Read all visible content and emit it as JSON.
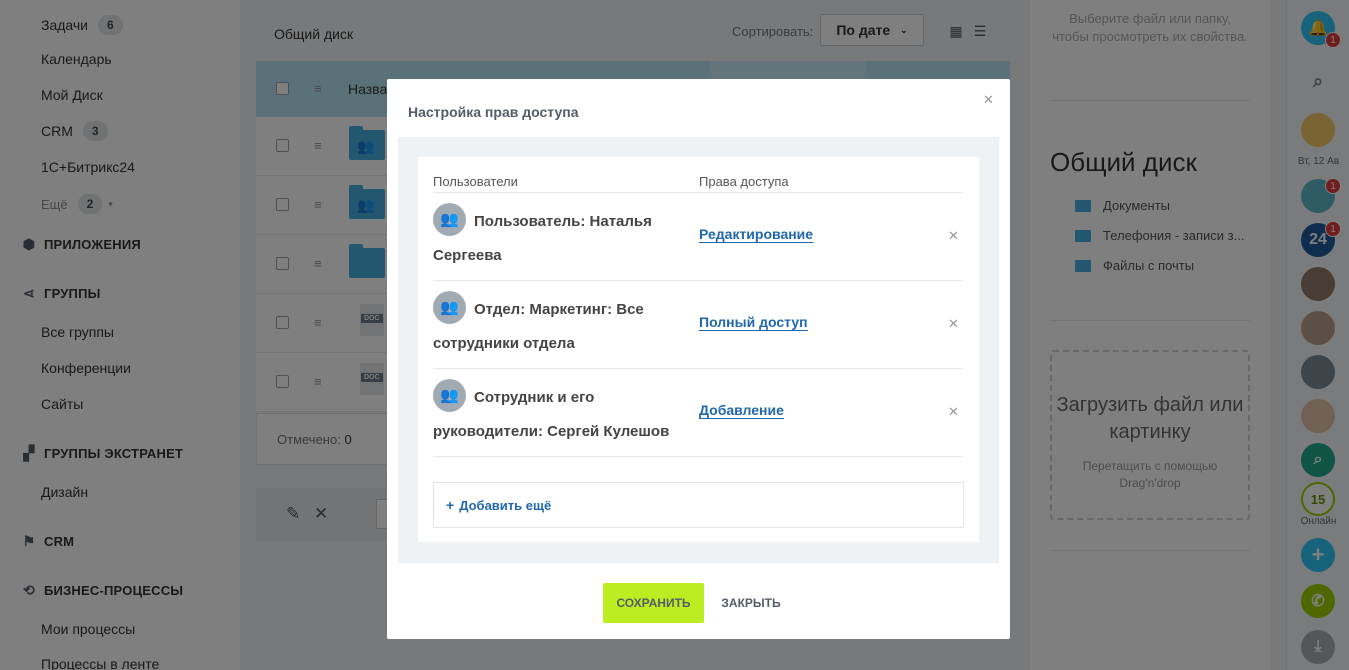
{
  "sidebar": {
    "tasks": {
      "label": "Задачи",
      "count": "6"
    },
    "calendar": "Календарь",
    "my_disk": "Мой Диск",
    "crm": {
      "label": "CRM",
      "count": "3"
    },
    "onec": "1С+Битрикс24",
    "more": {
      "label": "Ещё",
      "count": "2"
    },
    "sections": {
      "apps": "ПРИЛОЖЕНИЯ",
      "groups": "ГРУППЫ",
      "extranet": "ГРУППЫ ЭКСТРАНЕТ",
      "crm": "CRM",
      "bp": "БИЗНЕС-ПРОЦЕССЫ"
    },
    "groups_items": [
      "Все группы",
      "Конференции",
      "Сайты"
    ],
    "extranet_items": [
      "Дизайн"
    ],
    "bp_items": [
      "Мои процессы",
      "Процессы в ленте"
    ]
  },
  "main": {
    "breadcrumb": "Общий диск",
    "sort_label": "Сортировать:",
    "sort_value": "По дате",
    "table_header_name": "Назва",
    "doc_tag": "DOC",
    "marked_label": "Отмечено:",
    "marked_count": "0"
  },
  "right_panel": {
    "hint": "Выберите файл или папку, чтобы просмотреть их свойства.",
    "title": "Общий диск",
    "folders": [
      "Документы",
      "Телефония - записи з...",
      "Файлы с почты"
    ],
    "upload_title": "Загрузить файл или картинку",
    "upload_sub": "Перетащить с помощью Drag'n'drop"
  },
  "right_bar": {
    "notif_count": "1",
    "date": "Вт, 12 Ав",
    "chat1_badge": "1",
    "b24_label": "24",
    "b24_badge": "1",
    "online_count": "15",
    "online_label": "Онлайн"
  },
  "modal": {
    "title": "Настройка прав доступа",
    "col_users": "Пользователи",
    "col_access": "Права доступа",
    "rows": [
      {
        "user": "Пользователь: Наталья Сергеева",
        "access": "Редактирование"
      },
      {
        "user": "Отдел: Маркетинг: Все сотрудники отдела",
        "access": "Полный доступ"
      },
      {
        "user": "Сотрудник и его руководители: Сергей Кулешов",
        "access": "Добавление"
      }
    ],
    "add_more": "Добавить ещё",
    "save": "СОХРАНИТЬ",
    "close": "ЗАКРЫТЬ"
  },
  "colors": {
    "accent_green": "#bbed21",
    "link_blue": "#2067b0",
    "folder_blue": "#47aede",
    "badge_red": "#e3393b"
  }
}
